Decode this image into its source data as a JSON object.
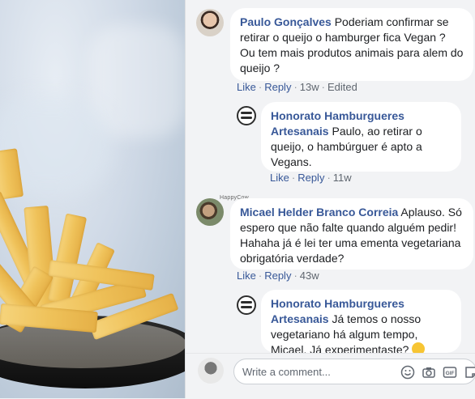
{
  "comments": [
    {
      "author": "Paulo Gonçalves",
      "text": "Poderiam confirmar se retirar o queijo o hamburger fica Vegan ? Ou tem mais produtos animais para alem do queijo ?",
      "like": "Like",
      "reply": "Reply",
      "time": "13w",
      "edited": "Edited",
      "reply_comment": {
        "author": "Honorato Hamburgueres Artesanais",
        "text": "Paulo, ao retirar o queijo, o hambúrguer é apto a Vegans.",
        "like": "Like",
        "reply": "Reply",
        "time": "11w"
      }
    },
    {
      "author": "Micael Helder Branco Correia",
      "text": "Aplauso. Só espero que não falte quando alguém pedir! Hahaha já é lei ter uma ementa vegetariana obrigatória verdade?",
      "like": "Like",
      "reply": "Reply",
      "time": "43w",
      "reply_comment": {
        "author": "Honorato Hamburgueres Artesanais",
        "text": "Já temos o nosso vegetariano há algum tempo, Micael. Já experimentaste?"
      }
    }
  ],
  "watermark": "HappyCow",
  "composer": {
    "placeholder": "Write a comment..."
  },
  "icons": [
    "emoji-icon",
    "camera-icon",
    "gif-icon",
    "sticker-icon"
  ]
}
